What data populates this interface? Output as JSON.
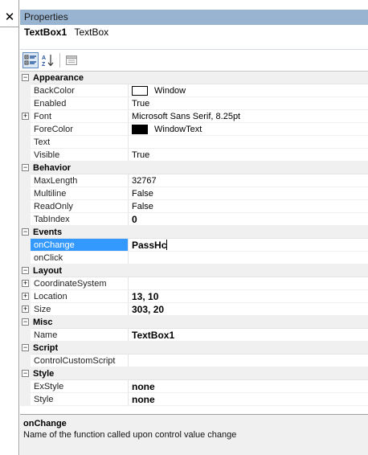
{
  "close_glyph": "✕",
  "panel": {
    "title": "Properties",
    "object_name": "TextBox1",
    "object_type": "TextBox"
  },
  "toolbar": {
    "categorized_icon": "categorized-icon",
    "alphabetical_icon": "alphabetical-icon",
    "property_pages_icon": "property-pages-icon"
  },
  "categories": [
    {
      "name": "Appearance",
      "props": [
        {
          "name": "BackColor",
          "value": "Window",
          "swatch": "#ffffff"
        },
        {
          "name": "Enabled",
          "value": "True"
        },
        {
          "name": "Font",
          "value": "Microsoft Sans Serif, 8.25pt",
          "expandable": true
        },
        {
          "name": "ForeColor",
          "value": "WindowText",
          "swatch": "#000000"
        },
        {
          "name": "Text",
          "value": ""
        },
        {
          "name": "Visible",
          "value": "True"
        }
      ]
    },
    {
      "name": "Behavior",
      "props": [
        {
          "name": "MaxLength",
          "value": "32767"
        },
        {
          "name": "Multiline",
          "value": "False"
        },
        {
          "name": "ReadOnly",
          "value": "False"
        },
        {
          "name": "TabIndex",
          "value": "0",
          "bold": true
        }
      ]
    },
    {
      "name": "Events",
      "props": [
        {
          "name": "onChange",
          "value": "PassHc",
          "selected": true,
          "bold": true
        },
        {
          "name": "onClick",
          "value": ""
        }
      ]
    },
    {
      "name": "Layout",
      "props": [
        {
          "name": "CoordinateSystem",
          "value": "",
          "expandable": true
        },
        {
          "name": "Location",
          "value": "13, 10",
          "expandable": true,
          "bold": true
        },
        {
          "name": "Size",
          "value": "303, 20",
          "expandable": true,
          "bold": true
        }
      ]
    },
    {
      "name": "Misc",
      "props": [
        {
          "name": "Name",
          "value": "TextBox1",
          "bold": true
        }
      ]
    },
    {
      "name": "Script",
      "props": [
        {
          "name": "ControlCustomScript",
          "value": ""
        }
      ]
    },
    {
      "name": "Style",
      "props": [
        {
          "name": "ExStyle",
          "value": "none",
          "bold": true
        },
        {
          "name": "Style",
          "value": "none",
          "bold": true
        }
      ]
    }
  ],
  "description": {
    "title": "onChange",
    "text": "Name of the function called upon control value change"
  },
  "expander": {
    "collapse": "−",
    "expand": "+"
  }
}
